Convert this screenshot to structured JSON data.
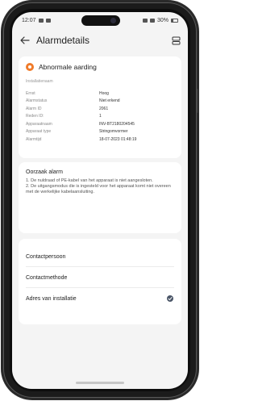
{
  "status": {
    "time": "12:07",
    "battery": "30%"
  },
  "header": {
    "title": "Alarmdetails"
  },
  "alarm": {
    "title": "Abnormale aarding",
    "section_label": "Installatienaam",
    "rows": [
      {
        "key": "Ernst",
        "value": "Hoog"
      },
      {
        "key": "Alarmstatus",
        "value": "Niet erkend"
      },
      {
        "key": "Alarm ID",
        "value": "2061"
      },
      {
        "key": "Reden ID:",
        "value": "1"
      },
      {
        "key": "Apparaatnaam",
        "value": "INV-BT2180204545"
      },
      {
        "key": "Apparaat type",
        "value": "Stringomvormer"
      },
      {
        "key": "Alarmtijd",
        "value": "18-07-2023 01:48:19"
      }
    ]
  },
  "cause": {
    "title": "Oorzaak alarm",
    "lines": [
      "1. De nuldraad of PE-kabel van het apparaat is niet aangesloten.",
      "2. De uitgangsmodus die is ingesteld voor het apparaat komt niet overeen met de werkelijke kabelaansluiting."
    ]
  },
  "nav": {
    "items": [
      {
        "label": "Contactpersoon"
      },
      {
        "label": "Contactmethode"
      },
      {
        "label": "Adres van installatie"
      }
    ]
  },
  "colors": {
    "alarm_accent": "#f07b2a",
    "check_badge": "#4a5567"
  }
}
